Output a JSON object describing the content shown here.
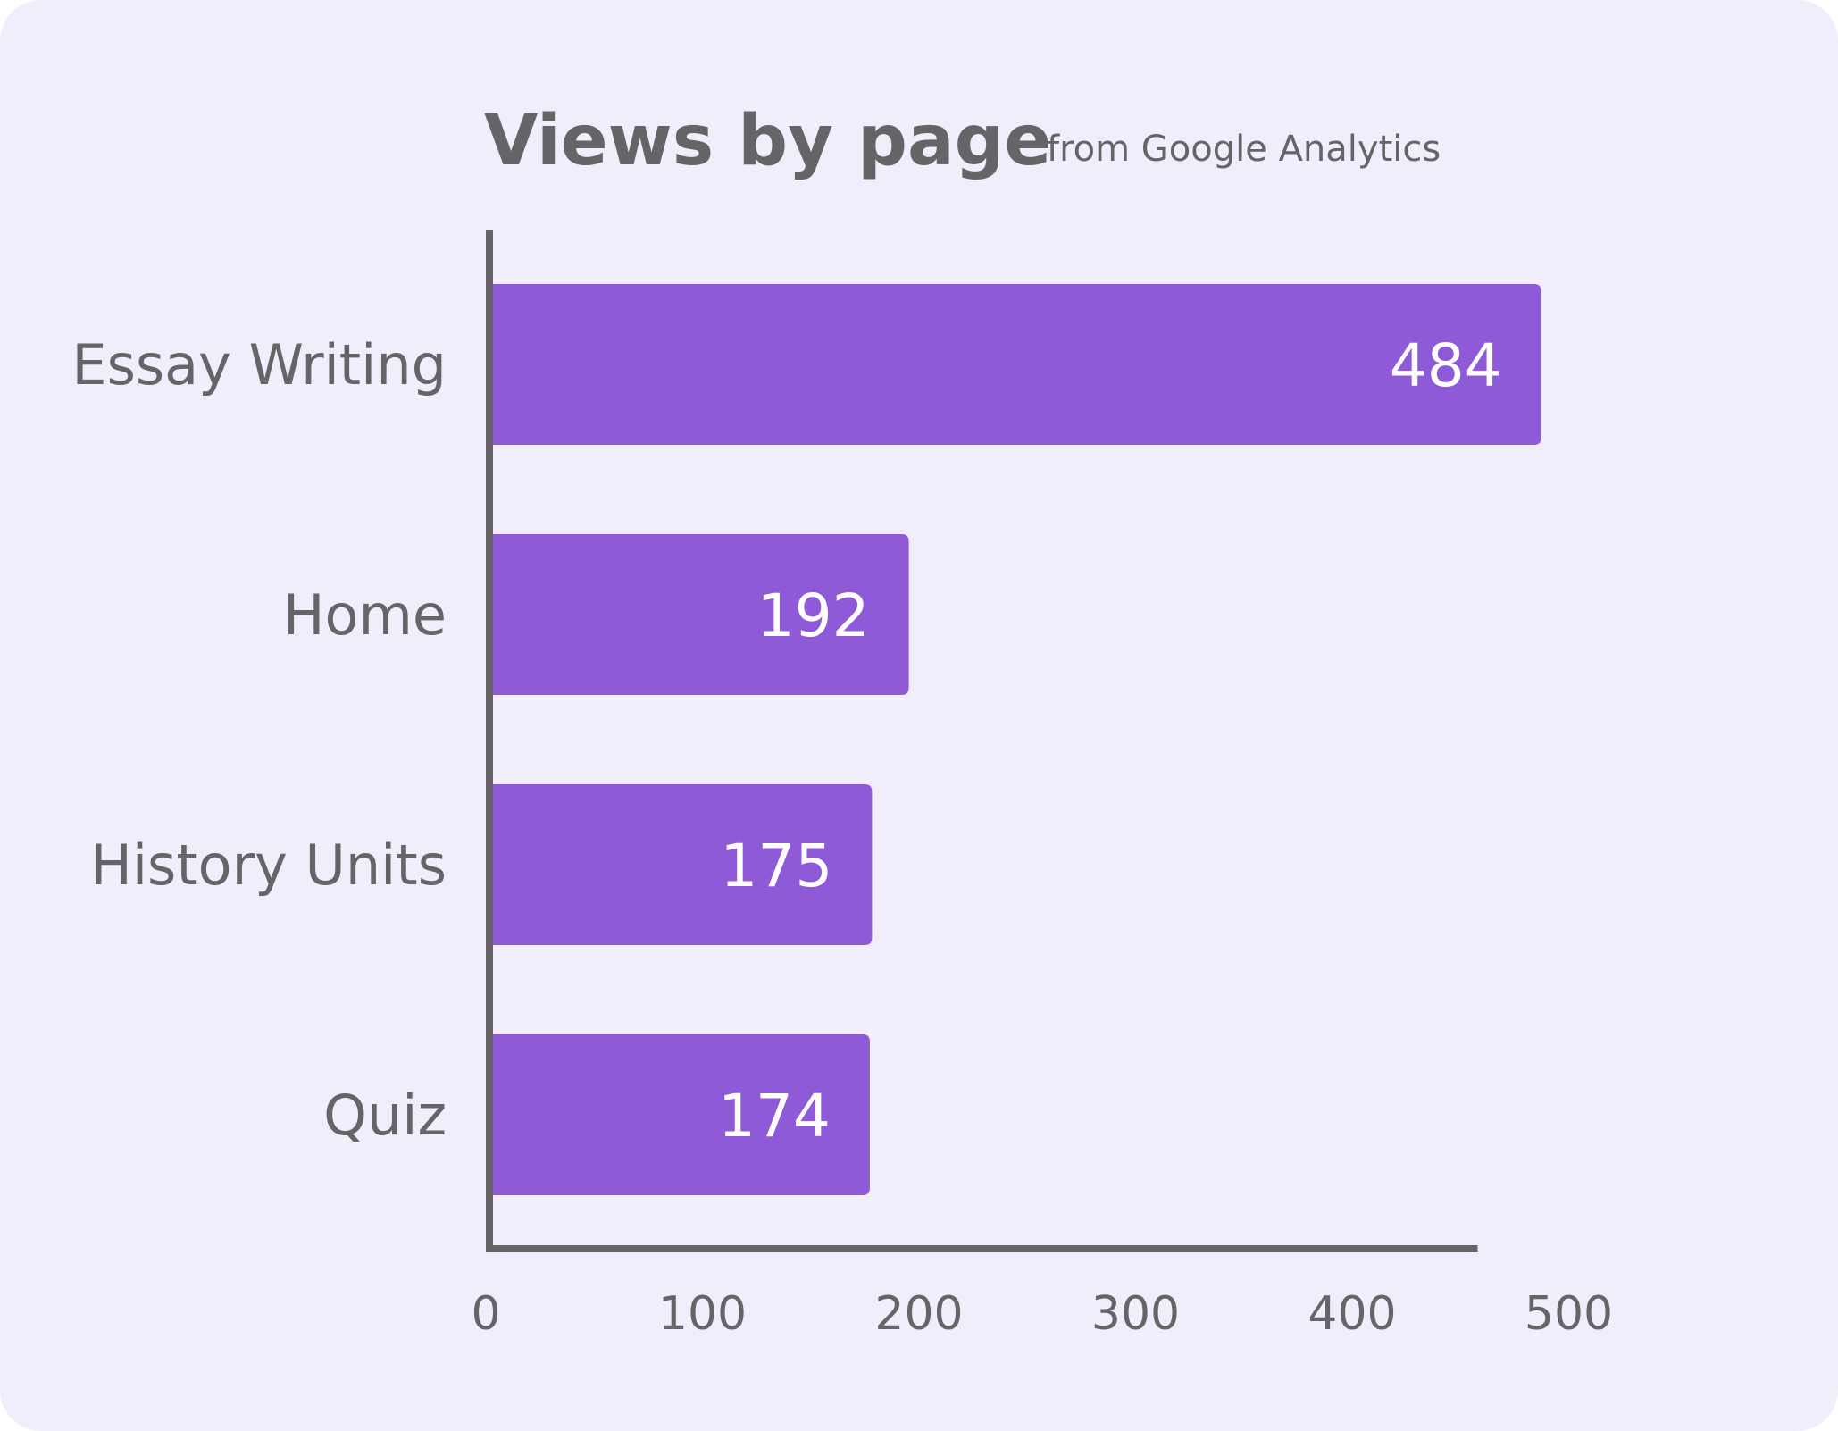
{
  "chart_data": {
    "type": "bar",
    "orientation": "horizontal",
    "title": "Views by page",
    "subtitle": "from Google Analytics",
    "categories": [
      "Essay Writing",
      "Home",
      "History Units",
      "Quiz"
    ],
    "values": [
      484,
      192,
      175,
      174
    ],
    "xlim": [
      0,
      500
    ],
    "xticks": [
      0,
      100,
      200,
      300,
      400,
      500
    ],
    "grid": false,
    "bar_color": "#8f5ad8",
    "axis_color": "#666466",
    "background_color": "#f1edfb"
  }
}
